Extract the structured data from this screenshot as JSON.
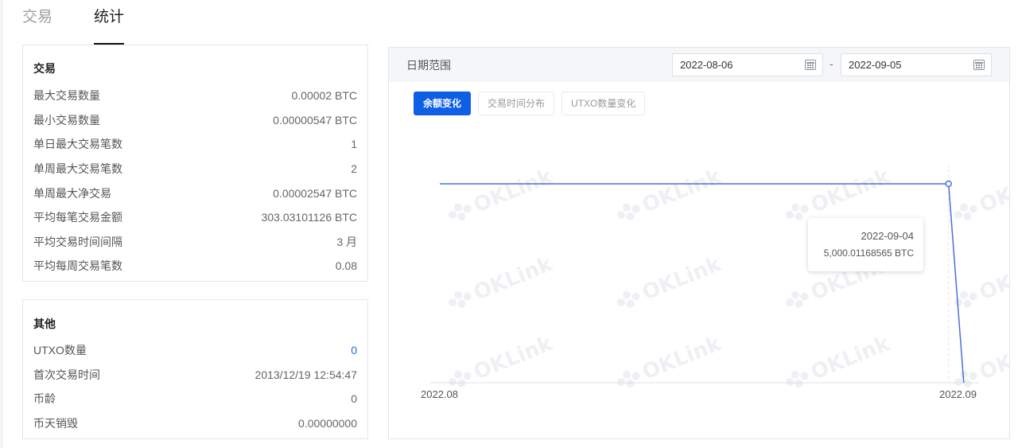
{
  "tabs": [
    {
      "label": "交易",
      "active": false
    },
    {
      "label": "统计",
      "active": true
    }
  ],
  "trade_card": {
    "title": "交易",
    "rows": [
      {
        "label": "最大交易数量",
        "value": "0.00002 BTC"
      },
      {
        "label": "最小交易数量",
        "value": "0.00000547 BTC"
      },
      {
        "label": "单日最大交易笔数",
        "value": "1"
      },
      {
        "label": "单周最大交易笔数",
        "value": "2"
      },
      {
        "label": "单周最大净交易",
        "value": "0.00002547 BTC"
      },
      {
        "label": "平均每笔交易金额",
        "value": "303.03101126 BTC"
      },
      {
        "label": "平均交易时间间隔",
        "value": "3 月"
      },
      {
        "label": "平均每周交易笔数",
        "value": "0.08"
      }
    ]
  },
  "other_card": {
    "title": "其他",
    "rows": [
      {
        "label": "UTXO数量",
        "value": "0"
      },
      {
        "label": "首次交易时间",
        "value": "2013/12/19 12:54:47"
      },
      {
        "label": "币龄",
        "value": "0"
      },
      {
        "label": "币天销毁",
        "value": "0.00000000"
      }
    ]
  },
  "chart_panel": {
    "range_label": "日期范围",
    "date_start": "2022-08-06",
    "date_end": "2022-09-05",
    "range_separator": "-",
    "chart_tabs": [
      {
        "label": "余额变化",
        "active": true
      },
      {
        "label": "交易时间分布",
        "active": false
      },
      {
        "label": "UTXO数量变化",
        "active": false
      }
    ],
    "watermark": "OKLink",
    "tooltip": {
      "date": "2022-09-04",
      "value": "5,000.01168565 BTC"
    },
    "line_color": "#4a6fd8",
    "accent_color": "#0f5fe6"
  },
  "chart_data": {
    "type": "line",
    "x_tick_labels": [
      "2022.08",
      "2022.09"
    ],
    "x": [
      "2022-08-06",
      "2022-09-04",
      "2022-09-05"
    ],
    "y": [
      5000.01168565,
      5000.01168565,
      0
    ],
    "series": [
      {
        "values": [
          5000.01168565,
          5000.01168565,
          0
        ]
      }
    ],
    "highlight": {
      "x": "2022-09-04",
      "y": 5000.01168565
    },
    "grid": false
  }
}
